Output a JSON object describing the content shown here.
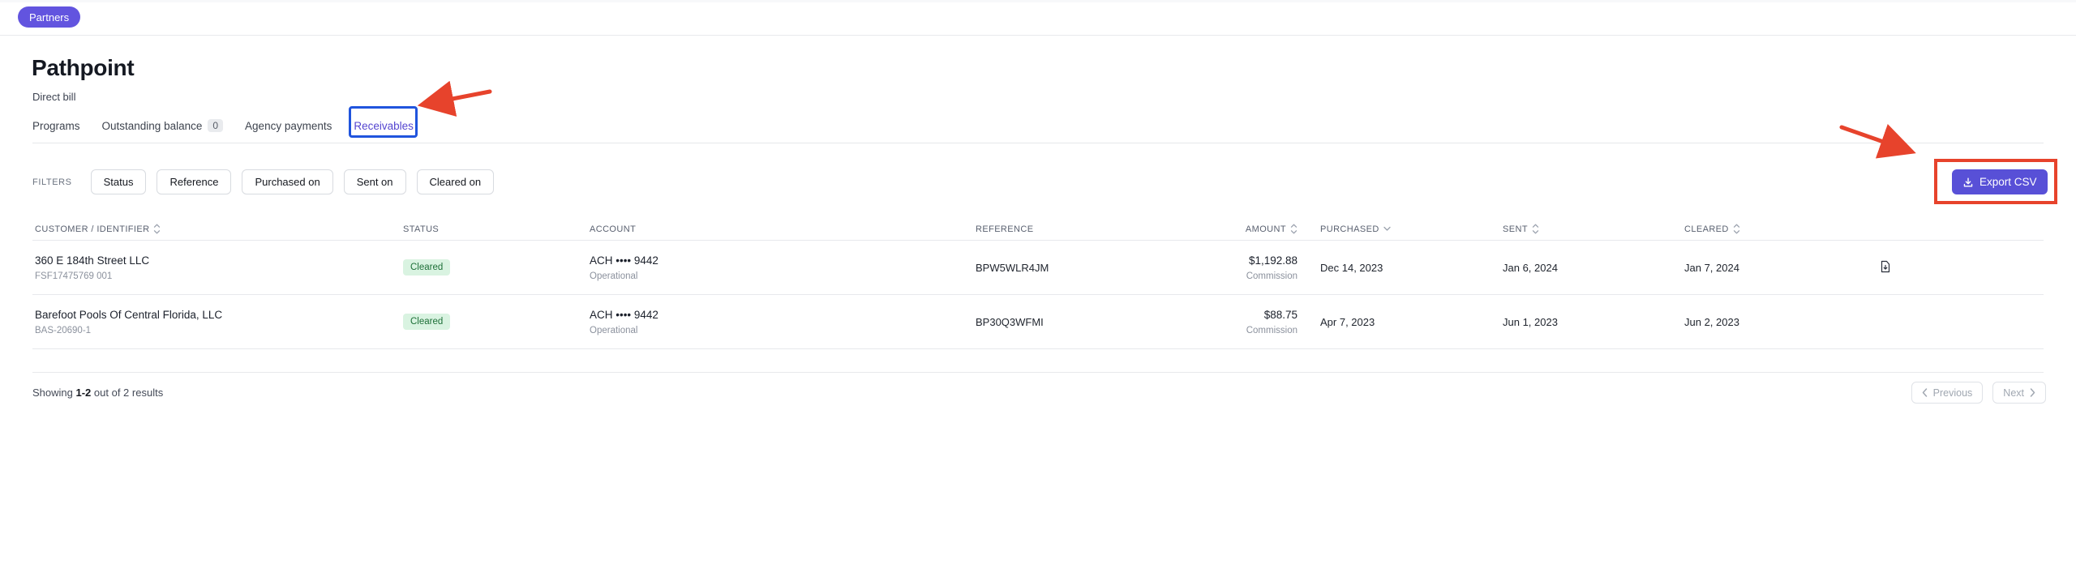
{
  "topbar": {
    "badge": "Partners"
  },
  "header": {
    "title": "Pathpoint",
    "subtitle": "Direct bill"
  },
  "tabs": [
    {
      "label": "Programs",
      "active": false
    },
    {
      "label": "Outstanding balance",
      "count": "0",
      "active": false
    },
    {
      "label": "Agency payments",
      "active": false
    },
    {
      "label": "Receivables",
      "active": true
    }
  ],
  "filters": {
    "label": "FILTERS",
    "buttons": [
      "Status",
      "Reference",
      "Purchased on",
      "Sent on",
      "Cleared on"
    ]
  },
  "export_button": {
    "label": "Export CSV"
  },
  "table": {
    "columns": [
      {
        "label": "CUSTOMER / IDENTIFIER",
        "sort": "both"
      },
      {
        "label": "STATUS",
        "sort": "none"
      },
      {
        "label": "ACCOUNT",
        "sort": "none"
      },
      {
        "label": "REFERENCE",
        "sort": "none"
      },
      {
        "label": "AMOUNT",
        "sort": "both"
      },
      {
        "label": "PURCHASED",
        "sort": "desc"
      },
      {
        "label": "SENT",
        "sort": "both"
      },
      {
        "label": "CLEARED",
        "sort": "both"
      }
    ],
    "rows": [
      {
        "customer": "360 E 184th Street LLC",
        "identifier": "FSF17475769 001",
        "status": "Cleared",
        "account": "ACH •••• 9442",
        "account_sub": "Operational",
        "reference": "BPW5WLR4JM",
        "amount": "$1,192.88",
        "amount_sub": "Commission",
        "purchased": "Dec 14, 2023",
        "sent": "Jan 6, 2024",
        "cleared": "Jan 7, 2024",
        "has_document": true
      },
      {
        "customer": "Barefoot Pools Of Central Florida, LLC",
        "identifier": "BAS-20690-1",
        "status": "Cleared",
        "account": "ACH •••• 9442",
        "account_sub": "Operational",
        "reference": "BP30Q3WFMI",
        "amount": "$88.75",
        "amount_sub": "Commission",
        "purchased": "Apr 7, 2023",
        "sent": "Jun 1, 2023",
        "cleared": "Jun 2, 2023",
        "has_document": false
      }
    ]
  },
  "footer": {
    "showing_prefix": "Showing",
    "range": "1-2",
    "showing_suffix": "out of 2 results",
    "previous": "Previous",
    "next": "Next"
  },
  "icons": {
    "export": "download-icon",
    "sortable": "sort-up-down-icon",
    "sorted_desc": "chevron-down-icon",
    "row_action": "document-download-icon",
    "prev": "chevron-left-icon",
    "next": "chevron-right-icon"
  },
  "colors": {
    "brand_purple": "#5850d7",
    "badge_purple": "#6254df",
    "active_tab_purple": "#5546d0",
    "status_green_bg": "#d9f3e1",
    "status_green_text": "#1e7038",
    "annotation_red": "#e7432c",
    "annotation_blue": "#2054dd"
  }
}
